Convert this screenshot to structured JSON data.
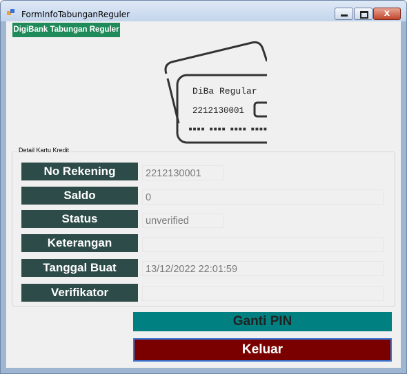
{
  "window": {
    "title": "FormInfoTabunganReguler",
    "close_symbol": "x"
  },
  "brand": {
    "label": "DigiBank Tabungan Reguler"
  },
  "card_art": {
    "name": "DiBa Regular",
    "number": "2212130001",
    "dots": "▪▪▪▪ ▪▪▪▪ ▪▪▪▪ ▪▪▪▪"
  },
  "details": {
    "legend": "Detail Kartu Kredit",
    "rows": [
      {
        "label": "No Rekening",
        "value": "2212130001"
      },
      {
        "label": "Saldo",
        "value": "0"
      },
      {
        "label": "Status",
        "value": "unverified"
      },
      {
        "label": "Keterangan",
        "value": ""
      },
      {
        "label": "Tanggal Buat",
        "value": "13/12/2022 22:01:59"
      },
      {
        "label": "Verifikator",
        "value": ""
      }
    ]
  },
  "actions": {
    "ganti_pin": "Ganti PIN",
    "keluar": "Keluar"
  },
  "colors": {
    "brand": "#1f8a5a",
    "label_bg": "#2d4b49",
    "ganti_pin_bg": "#008080",
    "keluar_bg": "#7a0000"
  }
}
